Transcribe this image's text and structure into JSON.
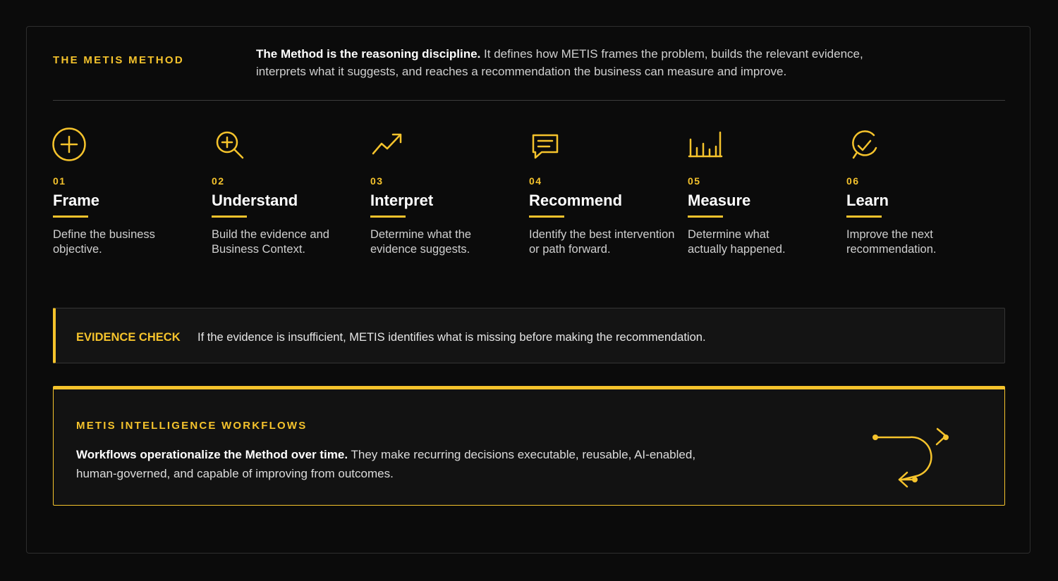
{
  "header": {
    "kicker": "THE METIS METHOD",
    "intro_bold": "The Method is the reasoning discipline.",
    "intro_text": " It defines how METIS frames the problem, builds the relevant evidence, interprets what it suggests, and reaches a recommendation the business can measure and improve."
  },
  "steps": [
    {
      "num": "01",
      "title": "Frame",
      "desc": "Define the business objective.",
      "icon": "plus-circle-icon"
    },
    {
      "num": "02",
      "title": "Understand",
      "desc": "Build the evidence and Business Context.",
      "icon": "zoom-in-icon"
    },
    {
      "num": "03",
      "title": "Interpret",
      "desc": "Determine what the evidence suggests.",
      "icon": "trend-up-icon"
    },
    {
      "num": "04",
      "title": "Recommend",
      "desc": "Identify the best intervention or path forward.",
      "icon": "message-icon"
    },
    {
      "num": "05",
      "title": "Measure",
      "desc": "Determine what actually happened.",
      "icon": "bar-chart-icon"
    },
    {
      "num": "06",
      "title": "Learn",
      "desc": "Improve the next recommendation.",
      "icon": "check-badge-icon"
    }
  ],
  "evidence_check": {
    "label": "EVIDENCE CHECK",
    "text": "If the evidence is insufficient, METIS identifies what is missing before making the recommendation."
  },
  "workflows": {
    "label": "METIS INTELLIGENCE WORKFLOWS",
    "text_bold": "Workflows operationalize the Method over time.",
    "text": " They make recurring decisions executable, reusable, AI-enabled, human-governed, and capable of improving from outcomes.",
    "icon": "loop-arrow-icon"
  },
  "colors": {
    "accent": "#f5c32c",
    "background": "#0b0b0b",
    "panel": "#141414"
  }
}
